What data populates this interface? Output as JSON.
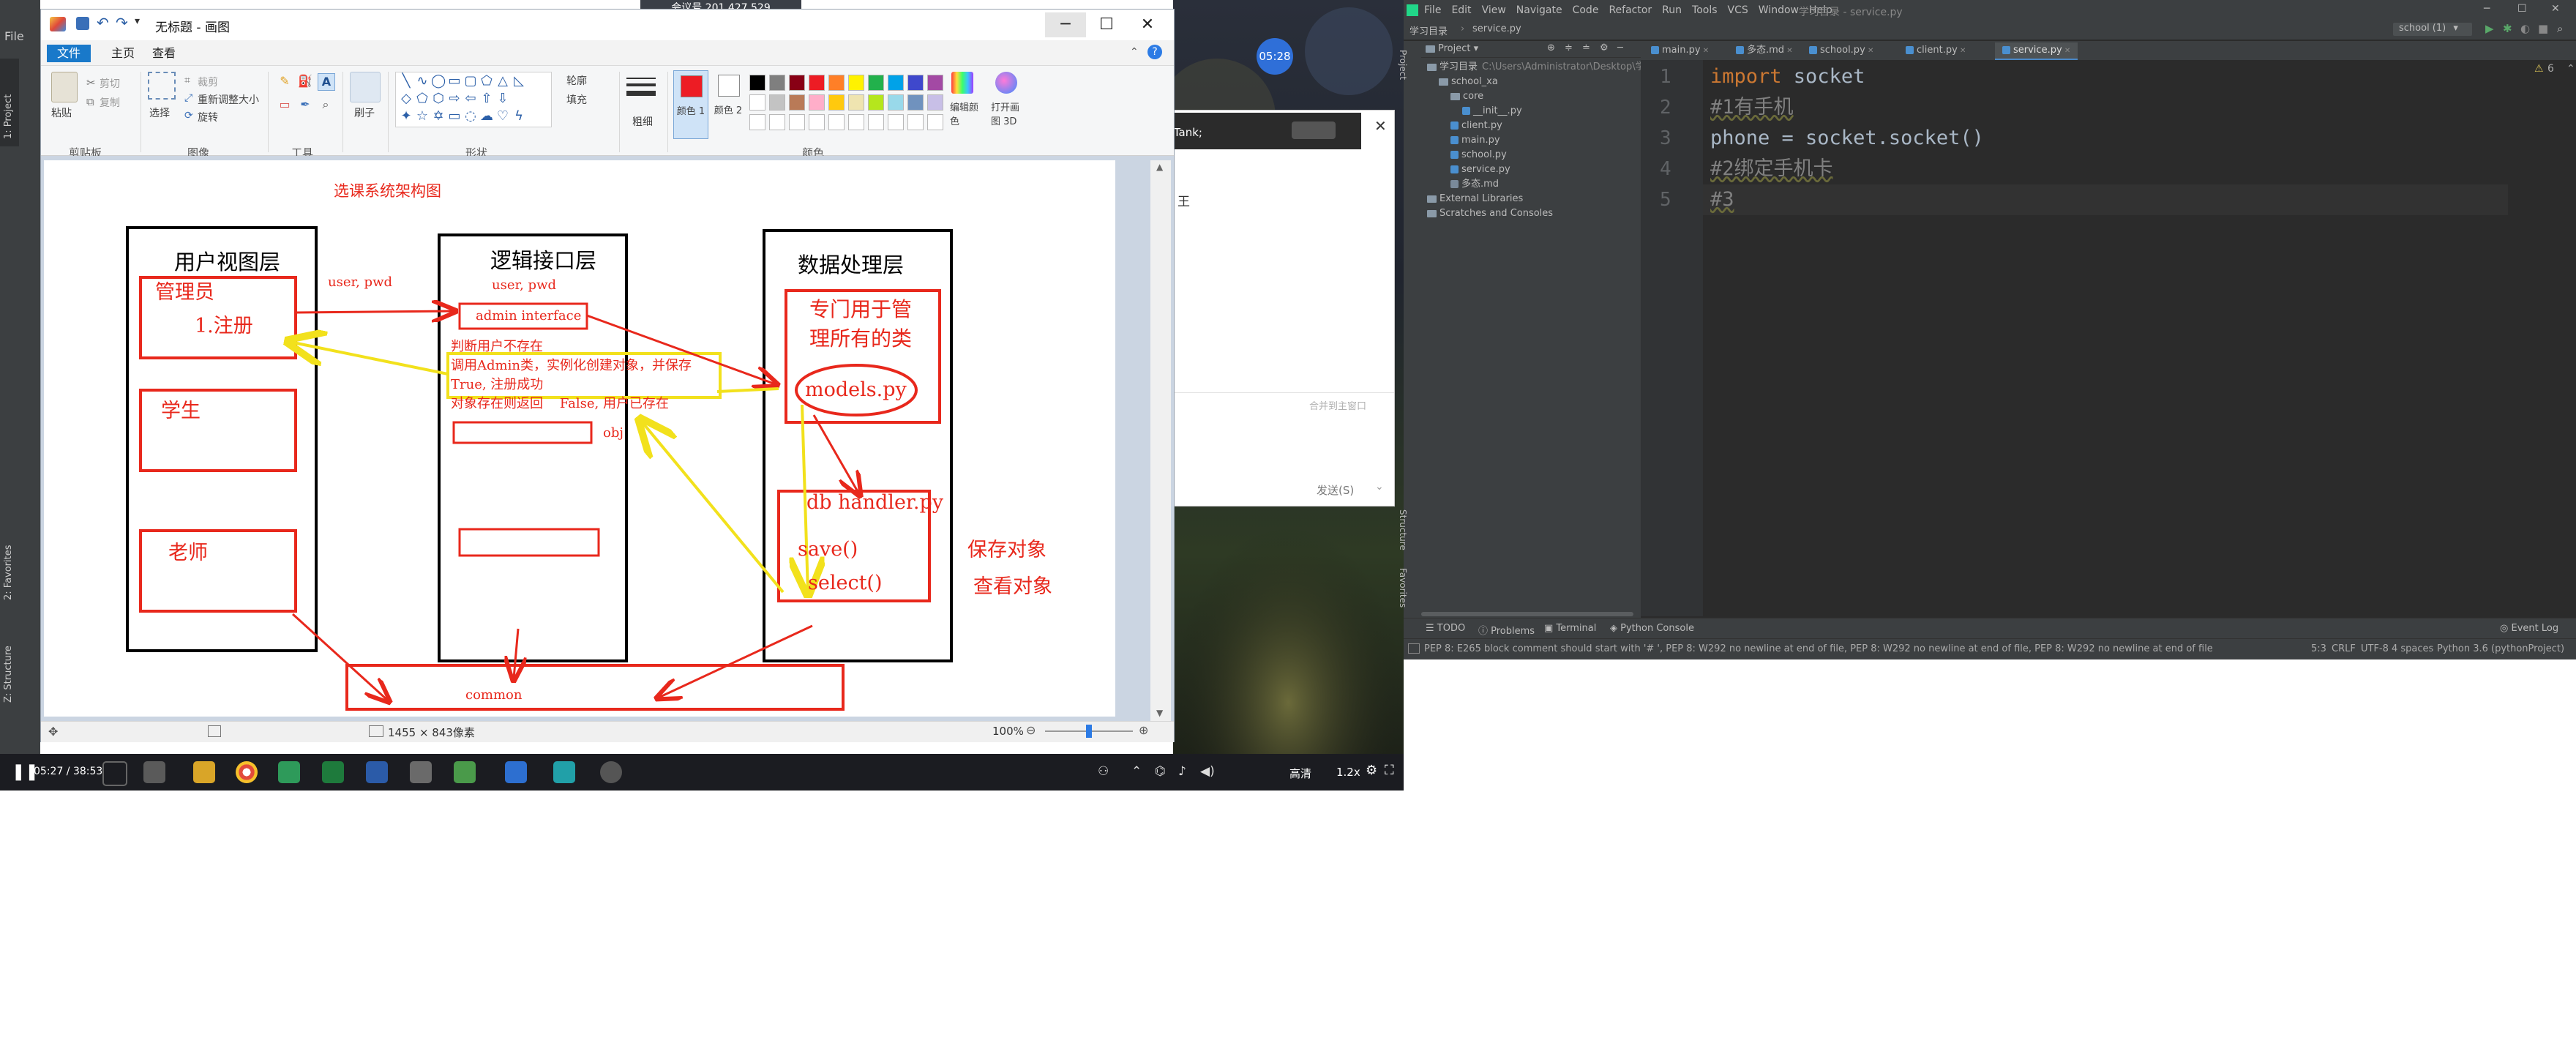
{
  "paint": {
    "title": "无标题 - 画图",
    "tabs": [
      "文件",
      "主页",
      "查看"
    ],
    "groups": {
      "clipboard": {
        "label": "剪贴板",
        "paste": "粘贴",
        "cut": "剪切",
        "copy": "复制"
      },
      "image": {
        "label": "图像",
        "select": "选择",
        "crop": "裁剪",
        "resize": "重新调整大小",
        "rotate": "旋转"
      },
      "tools": {
        "label": "工具"
      },
      "brushes": {
        "label": "刷子"
      },
      "shapes": {
        "label": "形状",
        "outline": "轮廓",
        "fill": "填充"
      },
      "size": {
        "label": "粗细"
      },
      "colors": {
        "label": "颜色",
        "color1": "颜色 1",
        "color2": "颜色 2",
        "edit": "编辑颜色",
        "open3d": "打开画图 3D"
      }
    },
    "palette_row1": [
      "#000000",
      "#7f7f7f",
      "#880015",
      "#ed1c24",
      "#ff7f27",
      "#fff200",
      "#22b14c",
      "#00a2e8",
      "#3f48cc",
      "#a349a4"
    ],
    "palette_row2": [
      "#ffffff",
      "#c3c3c3",
      "#b97a57",
      "#ffaec9",
      "#ffc90e",
      "#efe4b0",
      "#b5e61d",
      "#99d9ea",
      "#7092be",
      "#c8bfe7"
    ],
    "status": {
      "dimensions": "1455 × 843像素",
      "zoom": "100%"
    },
    "diagram": {
      "title": "选课系统架构图",
      "col1_title": "用户视图层",
      "col2_title": "逻辑接口层",
      "col3_title": "数据处理层",
      "admin": "管理员",
      "register": "1.注册",
      "student": "学生",
      "teacher": "老师",
      "user_pwd_1": "user, pwd",
      "user_pwd_2": "user, pwd",
      "admin_interface": "admin interface",
      "logic_line1": "判断用户不存在",
      "logic_line2": "调用Admin类，实例化创建对象，并保存",
      "logic_line3": "True, 注册成功",
      "logic_line4": "对象存在则返回    False, 用户已存在",
      "obj": "obj",
      "manage_line1": "专门用于管",
      "manage_line2": "理所有的类",
      "models": "models.py",
      "db_handler": "db handler.py",
      "save": "save()",
      "select": "select()",
      "save_obj": "保存对象",
      "view_obj": "查看对象",
      "common": "common"
    }
  },
  "overlay": {
    "meeting_id": "会议号 201 427 529",
    "timer": "05:28",
    "speaker": "正在讲话: Tank;",
    "chat_hint": "合并到主窗口",
    "send": "发送(S)",
    "side_char": "王"
  },
  "taskbar": {
    "time": "05:27 / 38:53",
    "quality": "高清",
    "speed": "1.2x"
  },
  "ide": {
    "title": "学习目录 - service.py",
    "menu": [
      "File",
      "Edit",
      "View",
      "Navigate",
      "Code",
      "Refactor",
      "Run",
      "Tools",
      "VCS",
      "Window",
      "Help"
    ],
    "breadcrumb": [
      "学习目录",
      "service.py"
    ],
    "run_config": "school (1)",
    "project_label": "Project",
    "tree": [
      {
        "indent": 0,
        "type": "folder",
        "label": "学习目录",
        "path": "C:\\Users\\Administrator\\Desktop\\学"
      },
      {
        "indent": 1,
        "type": "folder",
        "label": "school_xa"
      },
      {
        "indent": 2,
        "type": "folder",
        "label": "core"
      },
      {
        "indent": 3,
        "type": "py",
        "label": "__init__.py"
      },
      {
        "indent": 2,
        "type": "py",
        "label": "client.py"
      },
      {
        "indent": 2,
        "type": "py",
        "label": "main.py"
      },
      {
        "indent": 2,
        "type": "py",
        "label": "school.py"
      },
      {
        "indent": 2,
        "type": "py",
        "label": "service.py"
      },
      {
        "indent": 2,
        "type": "md",
        "label": "多态.md"
      },
      {
        "indent": 0,
        "type": "folder",
        "label": "External Libraries"
      },
      {
        "indent": 0,
        "type": "folder",
        "label": "Scratches and Consoles"
      }
    ],
    "tabs": [
      "main.py",
      "多态.md",
      "school.py",
      "client.py",
      "service.py"
    ],
    "active_tab": "service.py",
    "line_numbers": [
      "1",
      "2",
      "3",
      "4",
      "5"
    ],
    "code": [
      {
        "kw": "import",
        "rest": " socket"
      },
      {
        "comment": "#1有手机"
      },
      {
        "plain": "phone = socket.socket()"
      },
      {
        "comment": "#2绑定手机卡"
      },
      {
        "comment": "#3"
      }
    ],
    "warning_count": "6",
    "bottom_tabs": [
      "TODO",
      "Problems",
      "Terminal",
      "Python Console"
    ],
    "event_log": "Event Log",
    "status_msg": "PEP 8: E265 block comment should start with '# ', PEP 8: W292 no newline at end of file, PEP 8: W292 no newline at end of file, PEP 8: W292 no newline at end of file",
    "status_right": [
      "5:3",
      "CRLF",
      "UTF-8",
      "4 spaces",
      "Python 3.6 (pythonProject)"
    ],
    "side_tabs": [
      "Structure",
      "Favorites"
    ]
  },
  "left_strip": {
    "labels": [
      "1: Project",
      "2: Favorites",
      "Z: Structure"
    ],
    "menu": "File"
  }
}
